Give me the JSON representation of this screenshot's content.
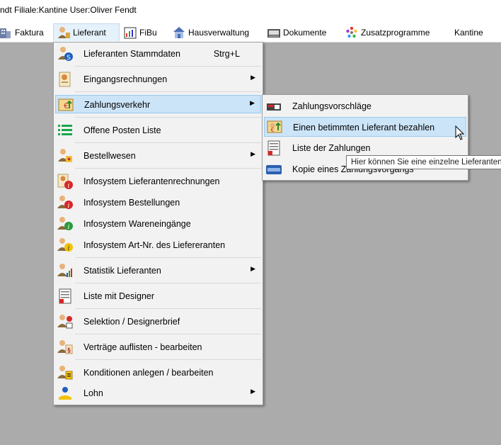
{
  "titlebar": {
    "text": "ndt Filiale:Kantine User:Oliver Fendt"
  },
  "menubar": {
    "items": [
      {
        "label": "Faktura",
        "icon": "faktura-building-icon"
      },
      {
        "label": "Lieferant",
        "icon": "lieferant-person-icon"
      },
      {
        "label": "FiBu",
        "icon": "fibu-chart-icon"
      },
      {
        "label": "Hausverwaltung",
        "icon": "house-icon"
      },
      {
        "label": "Dokumente",
        "icon": "document-tray-icon"
      },
      {
        "label": "Zusatzprogramme",
        "icon": "wheel-icon"
      },
      {
        "label": "Kantine",
        "icon": ""
      }
    ]
  },
  "lieferant_menu": {
    "items": [
      {
        "label": "Lieferanten Stammdaten",
        "shortcut": "Strg+L",
        "icon": "supplier-master-icon"
      },
      {
        "label": "Eingangsrechnungen",
        "submenu": true,
        "icon": "invoice-icon"
      },
      {
        "label": "Zahlungsverkehr",
        "submenu": true,
        "icon": "payment-icon",
        "highlighted": true
      },
      {
        "label": "Offene Posten Liste",
        "icon": "list-icon"
      },
      {
        "label": "Bestellwesen",
        "submenu": true,
        "icon": "order-icon"
      },
      {
        "label": "Infosystem Lieferantenrechnungen",
        "icon": "info-invoice-icon"
      },
      {
        "label": "Infosystem Bestellungen",
        "icon": "info-orders-icon"
      },
      {
        "label": "Infosystem Wareneingänge",
        "icon": "info-goods-icon"
      },
      {
        "label": "Infosystem Art-Nr. des Liefereranten",
        "icon": "info-article-icon"
      },
      {
        "label": "Statistik Lieferanten",
        "submenu": true,
        "icon": "statistics-icon"
      },
      {
        "label": "Liste mit Designer",
        "icon": "designer-list-icon"
      },
      {
        "label": "Selektion / Designerbrief",
        "icon": "selection-icon"
      },
      {
        "label": "Verträge auflisten - bearbeiten",
        "icon": "contract-icon"
      },
      {
        "label": "Konditionen anlegen / bearbeiten",
        "icon": "conditions-icon"
      },
      {
        "label": "Lohn",
        "submenu": true,
        "icon": "wage-icon"
      }
    ]
  },
  "zahlung_submenu": {
    "items": [
      {
        "label": "Zahlungsvorschläge",
        "icon": "payment-proposal-icon"
      },
      {
        "label": "Einen betimmten Lieferant bezahlen",
        "icon": "pay-supplier-icon",
        "highlighted": true
      },
      {
        "label": "Liste der Zahlungen",
        "icon": "payment-list-icon"
      },
      {
        "label": "Kopie eines Zahlungsvorgangs",
        "icon": "payment-copy-icon"
      }
    ]
  },
  "tooltip": {
    "text": "Hier können Sie eine einzelne Lieferanten"
  },
  "colors": {
    "highlight": "#cce4f7",
    "menu_bg": "#f2f2f2",
    "desktop": "#ababab"
  }
}
